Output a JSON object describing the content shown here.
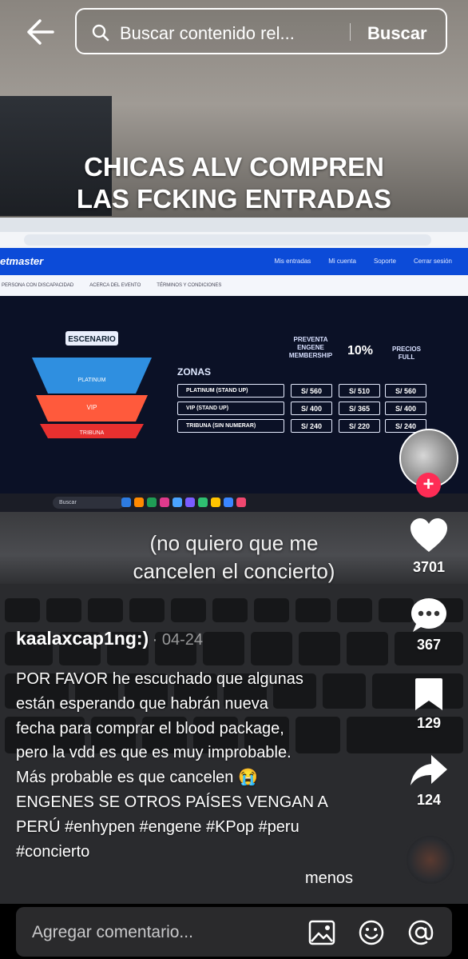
{
  "header": {
    "search_placeholder": "Buscar contenido rel...",
    "search_button": "Buscar"
  },
  "video": {
    "overlay_line1": "CHICAS ALV COMPREN",
    "overlay_line2": "LAS FCKING ENTRADAS",
    "subtitle_line1": "(no quiero que me",
    "subtitle_line2": "cancelen el concierto)",
    "screen": {
      "brand": "etmaster",
      "nav_links": [
        "Mis entradas",
        "Mi cuenta",
        "Soporte",
        "Cerrar sesión"
      ],
      "subnav": [
        "PERSONA CON DISCAPACIDAD",
        "ACERCA DEL EVENTO",
        "TÉRMINOS Y CONDICIONES"
      ],
      "stage_label": "ESCENARIO",
      "zone_map_labels": [
        "PLATINUM",
        "VIP",
        "TRIBUNA"
      ],
      "zones_title": "ZONAS",
      "columns": [
        "PREVENTA ENGENE MEMBERSHIP",
        "10%",
        "PRECIOS FULL"
      ],
      "zones": [
        {
          "name": "PLATINUM (STAND UP)",
          "presale": "S/ 560",
          "discount": "S/ 510",
          "full": "S/ 560"
        },
        {
          "name": "VIP (STAND UP)",
          "presale": "S/ 400",
          "discount": "S/ 365",
          "full": "S/ 400"
        },
        {
          "name": "TRIBUNA (SIN NUMERAR)",
          "presale": "S/ 240",
          "discount": "S/ 220",
          "full": "S/ 240"
        }
      ],
      "taskbar_search": "Buscar"
    }
  },
  "actions": {
    "likes": "3701",
    "comments": "367",
    "saves": "129",
    "shares": "124"
  },
  "post": {
    "author": "kaalaxcap1ng:)",
    "date": "· 04-24",
    "description": [
      "POR FAVOR he escuchado que algunas",
      "están esperando que habrán nueva",
      "fecha para comprar el blood package,",
      "pero la vdd es que es muy improbable.",
      "Más probable es que cancelen 😭",
      "ENGENES SE OTROS PAÍSES VENGAN A",
      "PERÚ #enhypen #engene #KPop #peru",
      "#concierto"
    ],
    "less_label": "menos"
  },
  "comment_bar": {
    "placeholder": "Agregar comentario..."
  },
  "colors": {
    "accent_red": "#fe2c55",
    "navbar_blue": "#0c4bd8"
  }
}
